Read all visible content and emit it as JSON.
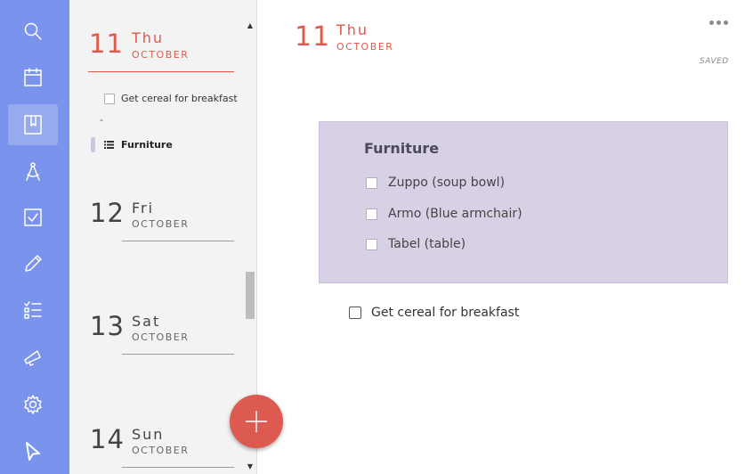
{
  "rail": {
    "icons": [
      "search-icon",
      "calendar-icon",
      "notebook-icon",
      "compass-icon",
      "checkbox-icon",
      "pencil-icon",
      "checklist-icon",
      "megaphone-icon",
      "gear-icon",
      "bookmark-cursor-icon"
    ],
    "active_index": 2,
    "color": "#7a93ec"
  },
  "days": [
    {
      "num": "11",
      "name": "Thu",
      "month": "OCTOBER"
    },
    {
      "num": "12",
      "name": "Fri",
      "month": "OCTOBER"
    },
    {
      "num": "13",
      "name": "Sat",
      "month": "OCTOBER"
    },
    {
      "num": "14",
      "name": "Sun",
      "month": "OCTOBER"
    }
  ],
  "sidebar_day1": {
    "task": "Get cereal for breakfast",
    "dash": "-",
    "list_label": "Furniture"
  },
  "main": {
    "num": "11",
    "name": "Thu",
    "month": "OCTOBER",
    "status": "SAVED",
    "card": {
      "title": "Furniture",
      "items": [
        "Zuppo (soup bowl)",
        "Armo (Blue armchair)",
        "Tabel (table)"
      ],
      "color": "#d8d1e5"
    },
    "task": "Get cereal for breakfast"
  },
  "fab": {
    "icon": "plus-icon",
    "color": "#dd5a50"
  },
  "accent": "#e05a4b"
}
